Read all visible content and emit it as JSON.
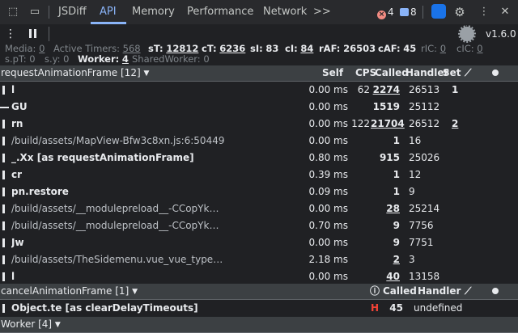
{
  "tabs": {
    "jsdiff": "JSDiff",
    "api": "API",
    "memory": "Memory",
    "performance": "Performance",
    "network": "Network",
    "more": ">>",
    "errors_count": "4",
    "messages_count": "8"
  },
  "toolbar": {
    "version": "v1.6.0"
  },
  "stats": {
    "media_label": "Media:",
    "media_value": "0",
    "timers_label": "Active Timers:",
    "timers_value": "568",
    "st_label": "sT:",
    "st_value": "12812",
    "ct_label": "cT:",
    "ct_value": "6236",
    "si_label": "sI:",
    "si_value": "83",
    "ci_label": "cI:",
    "ci_value": "84",
    "raf_label": "rAF:",
    "raf_value": "26503",
    "caf_label": "cAF:",
    "caf_value": "45",
    "ric_label": "rIC:",
    "ric_value": "0",
    "cic_label": "cIC:",
    "cic_value": "0",
    "spt_label": "s.pT:",
    "spt_value": "0",
    "sy_label": "s.y:",
    "sy_value": "0",
    "worker_label": "Worker:",
    "worker_value": "4",
    "shared_label": "SharedWorker:",
    "shared_value": "0"
  },
  "raf_section": {
    "title": "requestAnimationFrame [12]",
    "col_self": "Self",
    "col_cps": "CPS",
    "col_called": "Called",
    "col_handler": "Handler",
    "col_set": "Set",
    "rows": [
      {
        "name": "l",
        "type": "fn",
        "self": "0.00 ms",
        "cps": "62",
        "called": "2274",
        "called_u": true,
        "handler": "26513",
        "set": "1",
        "set_u": false
      },
      {
        "name": "GU",
        "type": "fn",
        "self": "0.00 ms",
        "cps": "",
        "called": "1519",
        "called_u": false,
        "handler": "25112",
        "set": "",
        "set_u": false
      },
      {
        "name": "rn",
        "type": "fn",
        "self": "0.00 ms",
        "cps": "122",
        "called": "21704",
        "called_u": true,
        "handler": "26512",
        "set": "2",
        "set_u": true
      },
      {
        "name": "/build/assets/MapView-Bfw3c8xn.js:6:50449",
        "type": "path",
        "self": "0.00 ms",
        "cps": "",
        "called": "1",
        "called_u": false,
        "handler": "16",
        "set": "",
        "set_u": false
      },
      {
        "name": "_.Xx [as requestAnimationFrame]",
        "type": "fn",
        "self": "0.80 ms",
        "cps": "",
        "called": "915",
        "called_u": false,
        "handler": "25026",
        "set": "",
        "set_u": false
      },
      {
        "name": "cr",
        "type": "fn",
        "self": "0.39 ms",
        "cps": "",
        "called": "1",
        "called_u": false,
        "handler": "12",
        "set": "",
        "set_u": false
      },
      {
        "name": "pn.restore",
        "type": "fn",
        "self": "0.09 ms",
        "cps": "",
        "called": "1",
        "called_u": false,
        "handler": "9",
        "set": "",
        "set_u": false
      },
      {
        "name": "/build/assets/__modulepreload__-CCopYk…",
        "type": "path",
        "self": "0.00 ms",
        "cps": "",
        "called": "28",
        "called_u": true,
        "handler": "25214",
        "set": "",
        "set_u": false
      },
      {
        "name": "/build/assets/__modulepreload__-CCopYk…",
        "type": "path",
        "self": "0.70 ms",
        "cps": "",
        "called": "9",
        "called_u": false,
        "handler": "7756",
        "set": "",
        "set_u": false
      },
      {
        "name": "Jw",
        "type": "fn",
        "self": "0.00 ms",
        "cps": "",
        "called": "9",
        "called_u": false,
        "handler": "7751",
        "set": "",
        "set_u": false
      },
      {
        "name": "/build/assets/TheSidemenu.vue_vue_type…",
        "type": "path",
        "self": "2.18 ms",
        "cps": "",
        "called": "2",
        "called_u": true,
        "handler": "3",
        "set": "",
        "set_u": false
      },
      {
        "name": "l",
        "type": "fn",
        "self": "0.00 ms",
        "cps": "",
        "called": "40",
        "called_u": true,
        "handler": "13158",
        "set": "",
        "set_u": false
      }
    ]
  },
  "caf_section": {
    "title": "cancelAnimationFrame [1]",
    "col_called": "Called",
    "col_handler": "Handler",
    "rows": [
      {
        "name": "Object.te [as clearDelayTimeouts]",
        "mark": "H",
        "called": "45",
        "handler": "undefined"
      }
    ]
  },
  "worker_section": {
    "title": "Worker [4]"
  }
}
